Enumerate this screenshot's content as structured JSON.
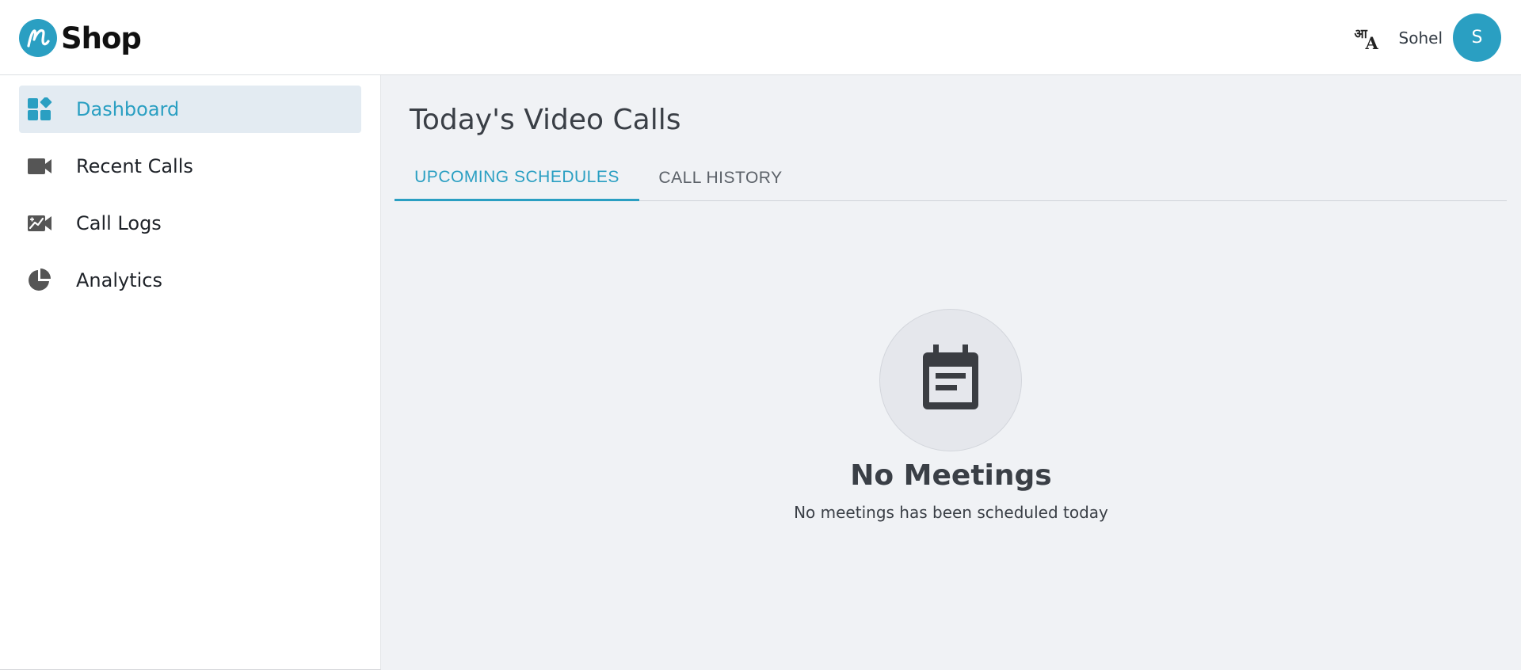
{
  "app": {
    "logo_text": "Shop",
    "logo_icon": "n-script-logo-icon"
  },
  "header": {
    "language_icon": "translate-icon",
    "language_glyph_primary": "आ",
    "language_glyph_secondary": "A",
    "user_name": "Sohel",
    "avatar_initial": "S"
  },
  "sidebar": {
    "items": [
      {
        "label": "Dashboard",
        "icon": "dashboard-icon",
        "active": true
      },
      {
        "label": "Recent Calls",
        "icon": "video-camera-icon",
        "active": false
      },
      {
        "label": "Call Logs",
        "icon": "call-logs-icon",
        "active": false
      },
      {
        "label": "Analytics",
        "icon": "pie-chart-icon",
        "active": false
      }
    ]
  },
  "main": {
    "title": "Today's Video Calls",
    "tabs": [
      {
        "label": "UPCOMING SCHEDULES",
        "active": true
      },
      {
        "label": "CALL HISTORY",
        "active": false
      }
    ],
    "empty_state": {
      "icon": "calendar-icon",
      "title": "No Meetings",
      "subtitle": "No meetings has been scheduled today"
    }
  },
  "colors": {
    "accent": "#2a9fc2",
    "active_nav_bg": "#e3ebf2",
    "main_bg": "#f0f2f5",
    "text_dark": "#3a3f46",
    "icon_gray": "#555555"
  }
}
